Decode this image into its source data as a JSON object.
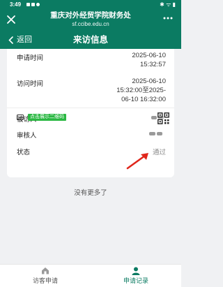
{
  "status_bar": {
    "time": "3:49",
    "right": "✱ ᯤ ▮"
  },
  "header": {
    "title": "重庆对外经贸学院财务处",
    "url": "sf.ccibe.edu.cn",
    "close_icon": "close-icon",
    "more_icon": "more-dots-icon"
  },
  "nav": {
    "back_label": "返回",
    "title": "来访信息"
  },
  "record": {
    "apply_time_label": "申请时间",
    "apply_time_line1": "2025-06-10",
    "apply_time_line2": "15:32:57",
    "visit_time_label": "访问时间",
    "visit_time_line1": "2025-06-10",
    "visit_time_line2": "15:32:00至2025-",
    "visit_time_line3": "06-10 16:32:00",
    "visitee_label": "被访人",
    "reviewer_label": "审核人",
    "status_label": "状态",
    "status_value": "通过",
    "qr_button_label": "点击展示二维码"
  },
  "colors": {
    "brand": "#0b7b62",
    "qr_tag": "#2bb843",
    "arrow": "#e0261b"
  },
  "list_footer": "没有更多了",
  "tabs": [
    {
      "label": "访客申请",
      "icon": "home-icon",
      "active": false
    },
    {
      "label": "申请记录",
      "icon": "person-icon",
      "active": true
    }
  ]
}
